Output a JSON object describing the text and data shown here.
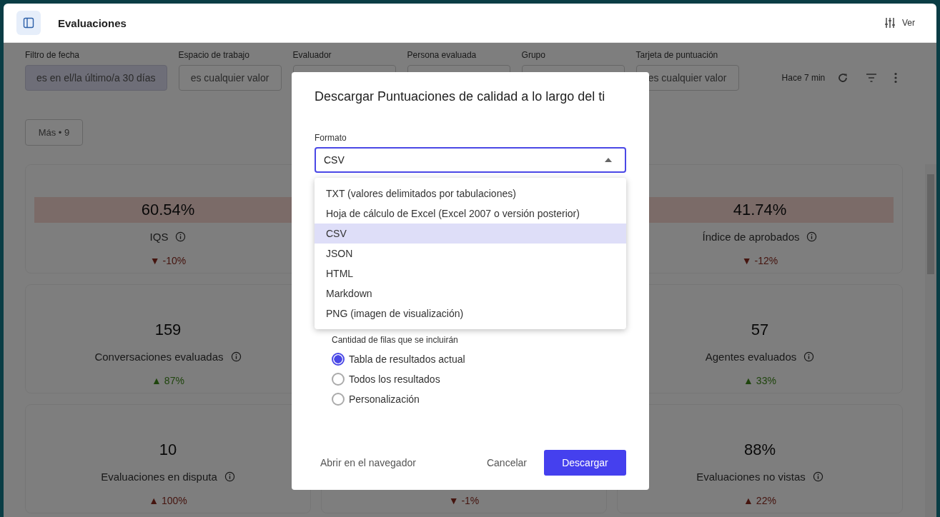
{
  "header": {
    "title": "Evaluaciones",
    "view_button": "Ver"
  },
  "filters": [
    {
      "label": "Filtro de fecha",
      "value": "es en el/la último/a 30 días",
      "active": true
    },
    {
      "label": "Espacio de trabajo",
      "value": "es cualquier valor",
      "active": false
    },
    {
      "label": "Evaluador",
      "active": false
    },
    {
      "label": "Persona evaluada",
      "active": false
    },
    {
      "label": "Grupo",
      "active": false
    },
    {
      "label": "Tarjeta de puntuación",
      "value": "es cualquier valor",
      "active": false
    }
  ],
  "updated": "Hace 7 min",
  "more_button": "Más • 9",
  "card_columns": [
    {
      "cards": [
        {
          "value": "60.54%",
          "label": "IQS",
          "highlighted": true,
          "change": {
            "arrow": "▼",
            "value": "-10%",
            "good": false
          }
        },
        {
          "value": "159",
          "label": "Conversaciones evaluadas",
          "highlighted": false,
          "change": {
            "arrow": "▲",
            "value": "87%",
            "good": true
          }
        },
        {
          "value": "10",
          "label": "Evaluaciones en disputa",
          "highlighted": false,
          "change": {
            "arrow": "▲",
            "value": "100%",
            "good": false
          }
        }
      ]
    },
    {
      "cards": [
        {
          "change": {
            "arrow": "▼",
            "value": "-1%",
            "good": false
          }
        }
      ]
    },
    {
      "cards": [
        {
          "value": "41.74%",
          "label": "Índice de aprobados",
          "highlighted": true,
          "change": {
            "arrow": "▼",
            "value": "-12%",
            "good": false
          }
        },
        {
          "value": "57",
          "label": "Agentes evaluados",
          "highlighted": false,
          "change": {
            "arrow": "▲",
            "value": "33%",
            "good": true
          }
        },
        {
          "value": "88%",
          "label": "Evaluaciones no vistas",
          "highlighted": false,
          "change": {
            "arrow": "▲",
            "value": "22%",
            "good": false
          }
        }
      ]
    }
  ],
  "dialog": {
    "title": "Descargar Puntuaciones de calidad a lo largo del ti",
    "format": {
      "label": "Formato",
      "value": "CSV",
      "expanded": true,
      "options": [
        {
          "label": "TXT (valores delimitados por tabulaciones)",
          "selected": false
        },
        {
          "label": "Hoja de cálculo de Excel (Excel 2007 o versión posterior)",
          "selected": false
        },
        {
          "label": "CSV",
          "selected": true
        },
        {
          "label": "JSON",
          "selected": false
        },
        {
          "label": "HTML",
          "selected": false
        },
        {
          "label": "Markdown",
          "selected": false
        },
        {
          "label": "PNG (imagen de visualización)",
          "selected": false
        }
      ]
    },
    "rows": {
      "label": "Cantidad de filas que se incluirán",
      "options": [
        {
          "label": "Tabla de resultados actual",
          "selected": true
        },
        {
          "label": "Todos los resultados",
          "selected": false
        },
        {
          "label": "Personalización",
          "selected": false
        }
      ]
    },
    "open_link": "Abrir en el navegador",
    "cancel": "Cancelar",
    "download": "Descargar"
  }
}
